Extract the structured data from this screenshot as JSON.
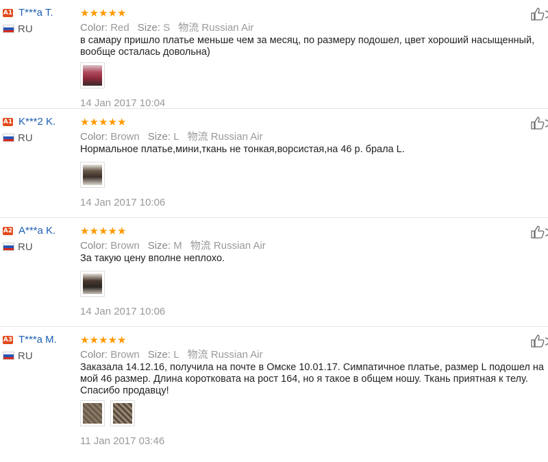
{
  "reviews": [
    {
      "badge": "A1",
      "name": "T***a T.",
      "country": "RU",
      "rating_stars": 5,
      "color_label": "Color:",
      "color_value": "Red",
      "size_label": "Size:",
      "size_value": "S",
      "shipping": "物流 Russian Air",
      "text": "в самару пришло платье меньше чем за месяц, по размеру подошел, цвет хороший насыщенный, вообще осталась довольна)",
      "photo_count": 1,
      "date": "14 Jan 2017 10:04"
    },
    {
      "badge": "A1",
      "name": "K***2 K.",
      "country": "RU",
      "rating_stars": 5,
      "color_label": "Color:",
      "color_value": "Brown",
      "size_label": "Size:",
      "size_value": "L",
      "shipping": "物流 Russian Air",
      "text": "Нормальное платье,мини,ткань не тонкая,ворсистая,на 46 р. брала L.",
      "photo_count": 1,
      "date": "14 Jan 2017 10:06"
    },
    {
      "badge": "A2",
      "name": "A***a K.",
      "country": "RU",
      "rating_stars": 5,
      "color_label": "Color:",
      "color_value": "Brown",
      "size_label": "Size:",
      "size_value": "M",
      "shipping": "物流 Russian Air",
      "text": "За такую цену вполне неплохо.",
      "photo_count": 1,
      "date": "14 Jan 2017 10:06"
    },
    {
      "badge": "A3",
      "name": "T***a M.",
      "country": "RU",
      "rating_stars": 5,
      "color_label": "Color:",
      "color_value": "Brown",
      "size_label": "Size:",
      "size_value": "L",
      "shipping": "物流 Russian Air",
      "text": "Заказала 14.12.16, получила на почте в Омске 10.01.17. Симпатичное платье, размер L подошел на мой 46 размер. Длина коротковата на рост 164, но я такое в общем ношу. Ткань приятная к телу. Спасибо продавцу!",
      "photo_count": 2,
      "date": "11 Jan 2017 03:46"
    }
  ],
  "colors": {
    "badge": "#e24a1b",
    "name": "#1a5fb4",
    "star": "#ff9900",
    "meta": "#999999"
  },
  "icons": {
    "star": "star-icon",
    "like": "thumbs-up-icon",
    "flag": "russia-flag-icon"
  }
}
